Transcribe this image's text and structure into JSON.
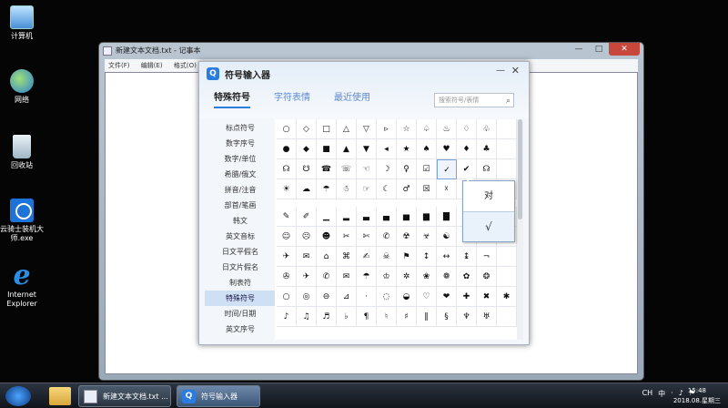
{
  "desktop": {
    "icons": [
      {
        "label": "计算机",
        "icon": "computer-icon"
      },
      {
        "label": "网络",
        "icon": "network-icon"
      },
      {
        "label": "回收站",
        "icon": "recycle-bin-icon"
      },
      {
        "label": "云骑士装机大师.exe",
        "icon": "app-icon"
      },
      {
        "label": "Internet Explorer",
        "icon": "ie-icon"
      }
    ]
  },
  "notepad": {
    "title": "新建文本文档.txt - 记事本",
    "menu": [
      "文件(F)",
      "编辑(E)",
      "格式(O)"
    ],
    "controls": {
      "minimize": "—",
      "maximize": "□",
      "close": "✕"
    }
  },
  "symbol_dialog": {
    "logo": "Q",
    "title": "符号输入器",
    "minimize": "—",
    "close": "✕",
    "tabs": [
      "特殊符号",
      "字符表情",
      "最近使用"
    ],
    "active_tab": 0,
    "search_placeholder": "搜索符号/表情",
    "categories": [
      "标点符号",
      "数字序号",
      "数字/单位",
      "希腊/俄文",
      "拼音/注音",
      "部首/笔画",
      "韩文",
      "英文音标",
      "日文平假名",
      "日文片假名",
      "制表符",
      "特殊符号",
      "时间/日期",
      "英文序号"
    ],
    "active_category": 11,
    "grid_block1": [
      "○",
      "◇",
      "□",
      "△",
      "▽",
      "▹",
      "☆",
      "♤",
      "♨",
      "♢",
      "♧",
      "",
      "●",
      "◆",
      "■",
      "▲",
      "▼",
      "◂",
      "★",
      "♠",
      "♥",
      "♦",
      "♣",
      "",
      "☊",
      "☋",
      "☎",
      "☏",
      "☜",
      "☽",
      "♀",
      "☑",
      "✓",
      "✔",
      "☊",
      "",
      "☀",
      "☁",
      "☂",
      "☃",
      "☞",
      "☾",
      "♂",
      "☒",
      "☓",
      "",
      "",
      ""
    ],
    "grid_block2": [
      "✎",
      "✐",
      "▁",
      "▂",
      "▃",
      "▄",
      "▅",
      "▆",
      "▇",
      "█",
      "▉",
      "",
      "☺",
      "☹",
      "☻",
      "✂",
      "✄",
      "✆",
      "☢",
      "☣",
      "☯",
      "☮",
      "☸",
      "",
      "✈",
      "✉",
      "⌂",
      "⌘",
      "✍",
      "☠",
      "⚑",
      "↕",
      "↔",
      "↨",
      "¬",
      "",
      "✇",
      "✈",
      "✆",
      "✉",
      "☂",
      "♔",
      "✲",
      "❀",
      "❁",
      "✿",
      "❂",
      "",
      "○",
      "◎",
      "⊖",
      "⊿",
      "·",
      "◌",
      "◒",
      "♡",
      "❤",
      "✚",
      "✖",
      "✱",
      "♪",
      "♫",
      "♬",
      "♭",
      "¶",
      "♮",
      "♯",
      "‖",
      "§",
      "♆",
      "♅",
      ""
    ],
    "popup": {
      "label": "对",
      "preview": "√"
    }
  },
  "taskbar": {
    "notepad_label": "新建文本文档.txt ...",
    "symbol_label": "符号输入器",
    "tray": [
      "CH",
      "中",
      "·",
      "♪",
      "⚑"
    ],
    "time": "15:48",
    "date": "2018.08.星期三"
  }
}
